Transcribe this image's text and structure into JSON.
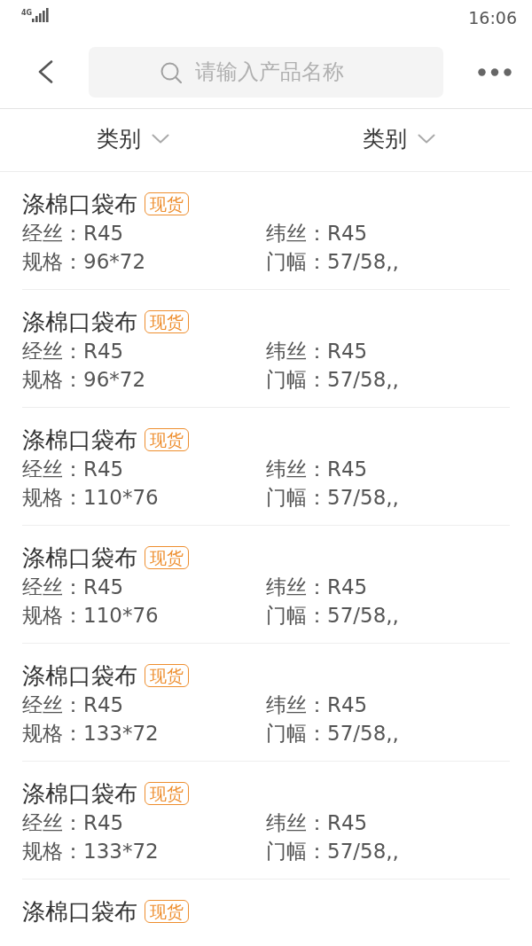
{
  "status_bar": {
    "network": "4G",
    "time": "16:06"
  },
  "header": {
    "search": {
      "placeholder": "请输入产品名称"
    }
  },
  "filters": [
    {
      "label": "类别"
    },
    {
      "label": "类别"
    }
  ],
  "products": [
    {
      "title": "涤棉口袋布",
      "badge": "现货",
      "fields": [
        "经丝：R45",
        "纬丝：R45",
        "规格：96*72",
        "门幅：57/58,,"
      ]
    },
    {
      "title": "涤棉口袋布",
      "badge": "现货",
      "fields": [
        "经丝：R45",
        "纬丝：R45",
        "规格：96*72",
        "门幅：57/58,,"
      ]
    },
    {
      "title": "涤棉口袋布",
      "badge": "现货",
      "fields": [
        "经丝：R45",
        "纬丝：R45",
        "规格：110*76",
        "门幅：57/58,,"
      ]
    },
    {
      "title": "涤棉口袋布",
      "badge": "现货",
      "fields": [
        "经丝：R45",
        "纬丝：R45",
        "规格：110*76",
        "门幅：57/58,,"
      ]
    },
    {
      "title": "涤棉口袋布",
      "badge": "现货",
      "fields": [
        "经丝：R45",
        "纬丝：R45",
        "规格：133*72",
        "门幅：57/58,,"
      ]
    },
    {
      "title": "涤棉口袋布",
      "badge": "现货",
      "fields": [
        "经丝：R45",
        "纬丝：R45",
        "规格：133*72",
        "门幅：57/58,,"
      ]
    },
    {
      "title": "涤棉口袋布",
      "badge": "现货"
    }
  ]
}
